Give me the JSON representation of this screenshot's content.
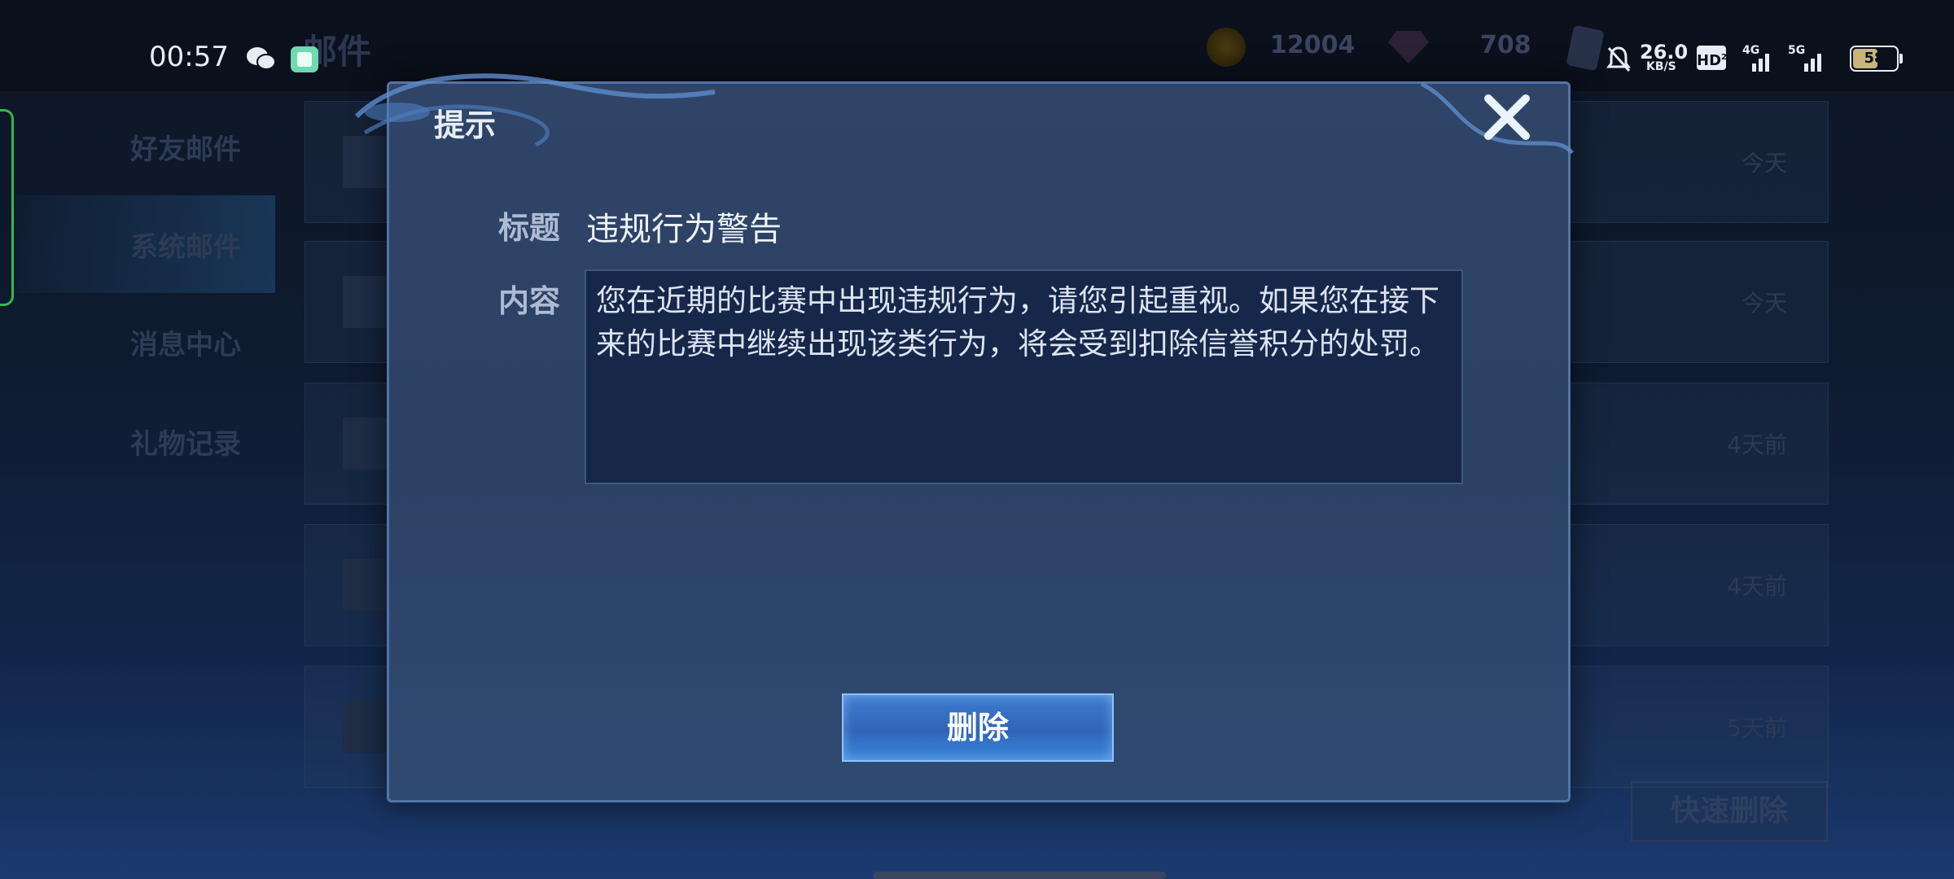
{
  "status_bar": {
    "time": "00:57",
    "net_speed": "26.0",
    "net_unit": "KB/S",
    "hd_label": "HD",
    "hd_sub": "2",
    "net_4g": "4G",
    "net_5g": "5G",
    "battery": "58"
  },
  "background": {
    "page_title": "邮件",
    "gold": "12004",
    "diamond": "708",
    "tabs": [
      "好友邮件",
      "系统邮件",
      "消息中心",
      "礼物记录"
    ],
    "mail_dates": [
      "今天",
      "今天",
      "4天前",
      "4天前",
      "5天前"
    ],
    "quick_delete_label": "快速删除"
  },
  "dialog": {
    "title": "提示",
    "subject_label": "标题",
    "subject_value": "违规行为警告",
    "content_label": "内容",
    "content_text": "您在近期的比赛中出现违规行为，请您引起重视。如果您在接下来的比赛中继续出现该类行为，将会受到扣除信誉积分的处罚。",
    "delete_label": "删除"
  }
}
